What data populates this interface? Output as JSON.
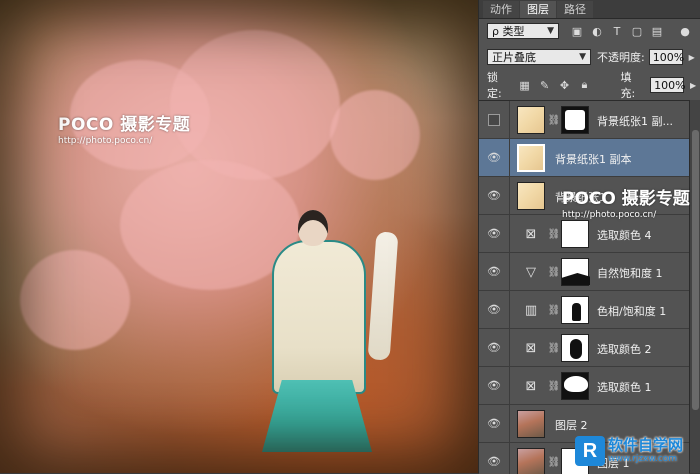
{
  "canvas": {
    "watermark_logo": "POCO 摄影专题",
    "watermark_url": "http://photo.poco.cn/"
  },
  "panel": {
    "tabs": [
      {
        "label": "动作",
        "active": false
      },
      {
        "label": "图层",
        "active": true
      },
      {
        "label": "路径",
        "active": false
      }
    ],
    "filter": {
      "label": "ρ 类型"
    },
    "blend_mode": "正片叠底",
    "opacity_label": "不透明度:",
    "opacity_value": "100%",
    "lock_label": "锁定:",
    "fill_label": "填充:",
    "fill_value": "100%",
    "watermark_logo": "POCO 摄影专题",
    "watermark_url": "http://photo.poco.cn/"
  },
  "layers": [
    {
      "name": "背景纸张1 副...",
      "visible": false,
      "thumb": "paper",
      "mask": "mask-top",
      "selected": false
    },
    {
      "name": "背景纸张1 副本",
      "visible": true,
      "thumb": "paper",
      "mask": null,
      "selected": true
    },
    {
      "name": "背景纸张1",
      "visible": true,
      "thumb": "paper",
      "mask": null,
      "selected": false
    },
    {
      "name": "选取颜色 4",
      "visible": true,
      "icon": "selective-color-icon",
      "mask": "white",
      "selected": false
    },
    {
      "name": "自然饱和度 1",
      "visible": true,
      "icon": "vibrance-icon",
      "mask": "mask-sat",
      "selected": false
    },
    {
      "name": "色相/饱和度 1",
      "visible": true,
      "icon": "hue-saturation-icon",
      "mask": "mask-hue",
      "selected": false
    },
    {
      "name": "选取颜色 2",
      "visible": true,
      "icon": "selective-color-icon",
      "mask": "mask-sel2",
      "selected": false
    },
    {
      "name": "选取颜色 1",
      "visible": true,
      "icon": "selective-color-icon",
      "mask": "mask-sel1",
      "selected": false
    },
    {
      "name": "图层 2",
      "visible": true,
      "thumb": "photo",
      "mask": null,
      "selected": false
    },
    {
      "name": "图层 1",
      "visible": true,
      "thumb": "photo",
      "mask": "white",
      "selected": false
    }
  ],
  "corner_logo": {
    "mark": "R",
    "brand": "软件自学网",
    "url": "www.rjzxw.com"
  }
}
